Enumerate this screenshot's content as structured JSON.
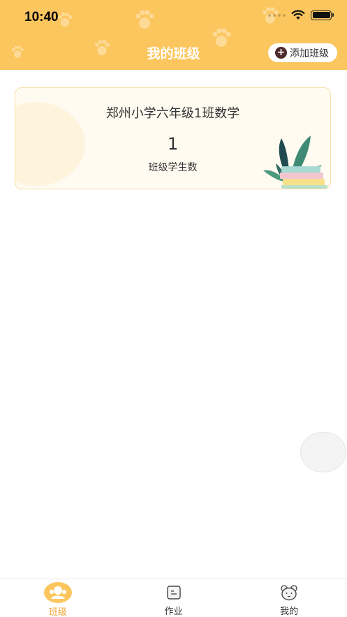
{
  "status_bar": {
    "time": "10:40"
  },
  "header": {
    "title": "我的班级",
    "add_button_label": "添加班级"
  },
  "class_card": {
    "name": "郑州小学六年级1班数学",
    "student_count": "1",
    "student_count_label": "班级学生数"
  },
  "tabbar": {
    "items": [
      {
        "label": "班级",
        "icon": "class-icon",
        "active": true
      },
      {
        "label": "作业",
        "icon": "homework-icon",
        "active": false
      },
      {
        "label": "我的",
        "icon": "profile-icon",
        "active": false
      }
    ]
  },
  "colors": {
    "header_bg": "#fcc65e",
    "active_tab": "#f0a93a",
    "card_bg": "#fffbf1"
  }
}
